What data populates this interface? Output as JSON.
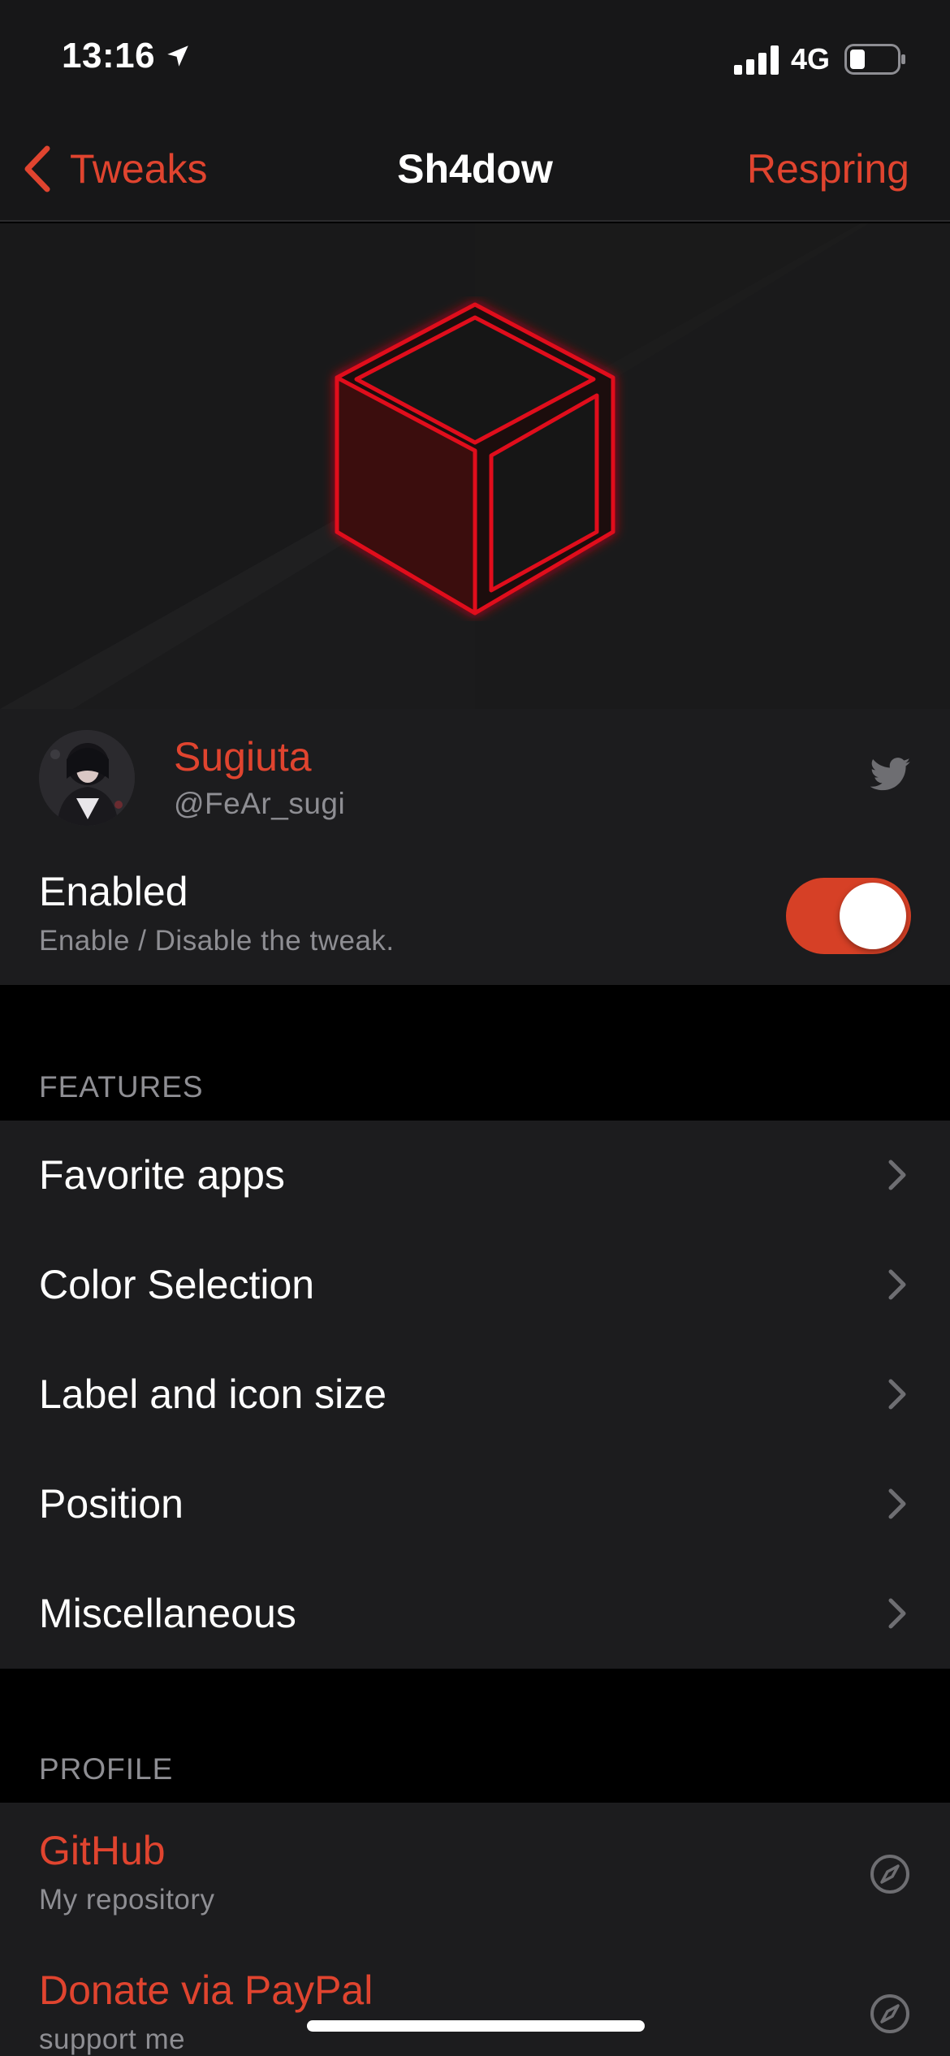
{
  "status_bar": {
    "time": "13:16",
    "network": "4G",
    "icons": [
      "location-arrow-icon",
      "cellular-signal-icon",
      "battery-icon"
    ]
  },
  "nav": {
    "back_label": "Tweaks",
    "title": "Sh4dow",
    "right_button": "Respring"
  },
  "hero": {
    "image": "neon-red-cube-logo"
  },
  "developer": {
    "name": "Sugiuta",
    "handle": "@FeAr_sugi",
    "icon": "twitter-icon"
  },
  "enabled_row": {
    "title": "Enabled",
    "subtitle": "Enable / Disable the tweak.",
    "state": true
  },
  "features": {
    "header": "FEATURES",
    "items": [
      {
        "label": "Favorite apps"
      },
      {
        "label": "Color Selection"
      },
      {
        "label": "Label and icon size"
      },
      {
        "label": "Position"
      },
      {
        "label": "Miscellaneous"
      }
    ]
  },
  "profile": {
    "header": "PROFILE",
    "items": [
      {
        "title": "GitHub",
        "subtitle": "My repository",
        "icon": "compass-icon"
      },
      {
        "title": "Donate via PayPal",
        "subtitle": "support me",
        "icon": "compass-icon"
      }
    ]
  },
  "colors": {
    "accent": "#e0442f",
    "toggle_on": "#d64026",
    "cell_background": "#1c1c1e",
    "page_background": "#000000",
    "secondary_text": "#8e8e93"
  }
}
